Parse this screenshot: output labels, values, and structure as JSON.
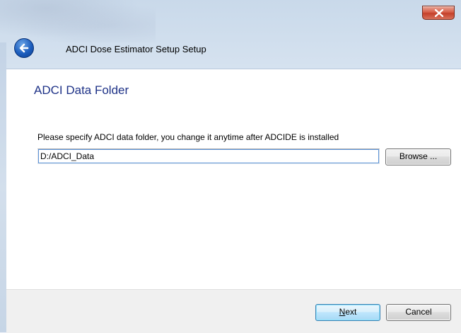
{
  "window": {
    "title": "ADCI Dose Estimator Setup Setup",
    "close_icon": "close-icon",
    "back_icon": "back-arrow-icon"
  },
  "page": {
    "heading": "ADCI Data Folder",
    "instruction": "Please specify ADCI data folder, you change it anytime after ADCIDE is installed"
  },
  "folder": {
    "value": "D:/ADCI_Data",
    "browse_label": "Browse ..."
  },
  "footer": {
    "next_label": "Next",
    "next_mnemonic": "N",
    "next_rest": "ext",
    "cancel_label": "Cancel"
  },
  "colors": {
    "heading": "#1e3287",
    "close_button": "#c4402a",
    "back_button": "#1c5dbd"
  }
}
